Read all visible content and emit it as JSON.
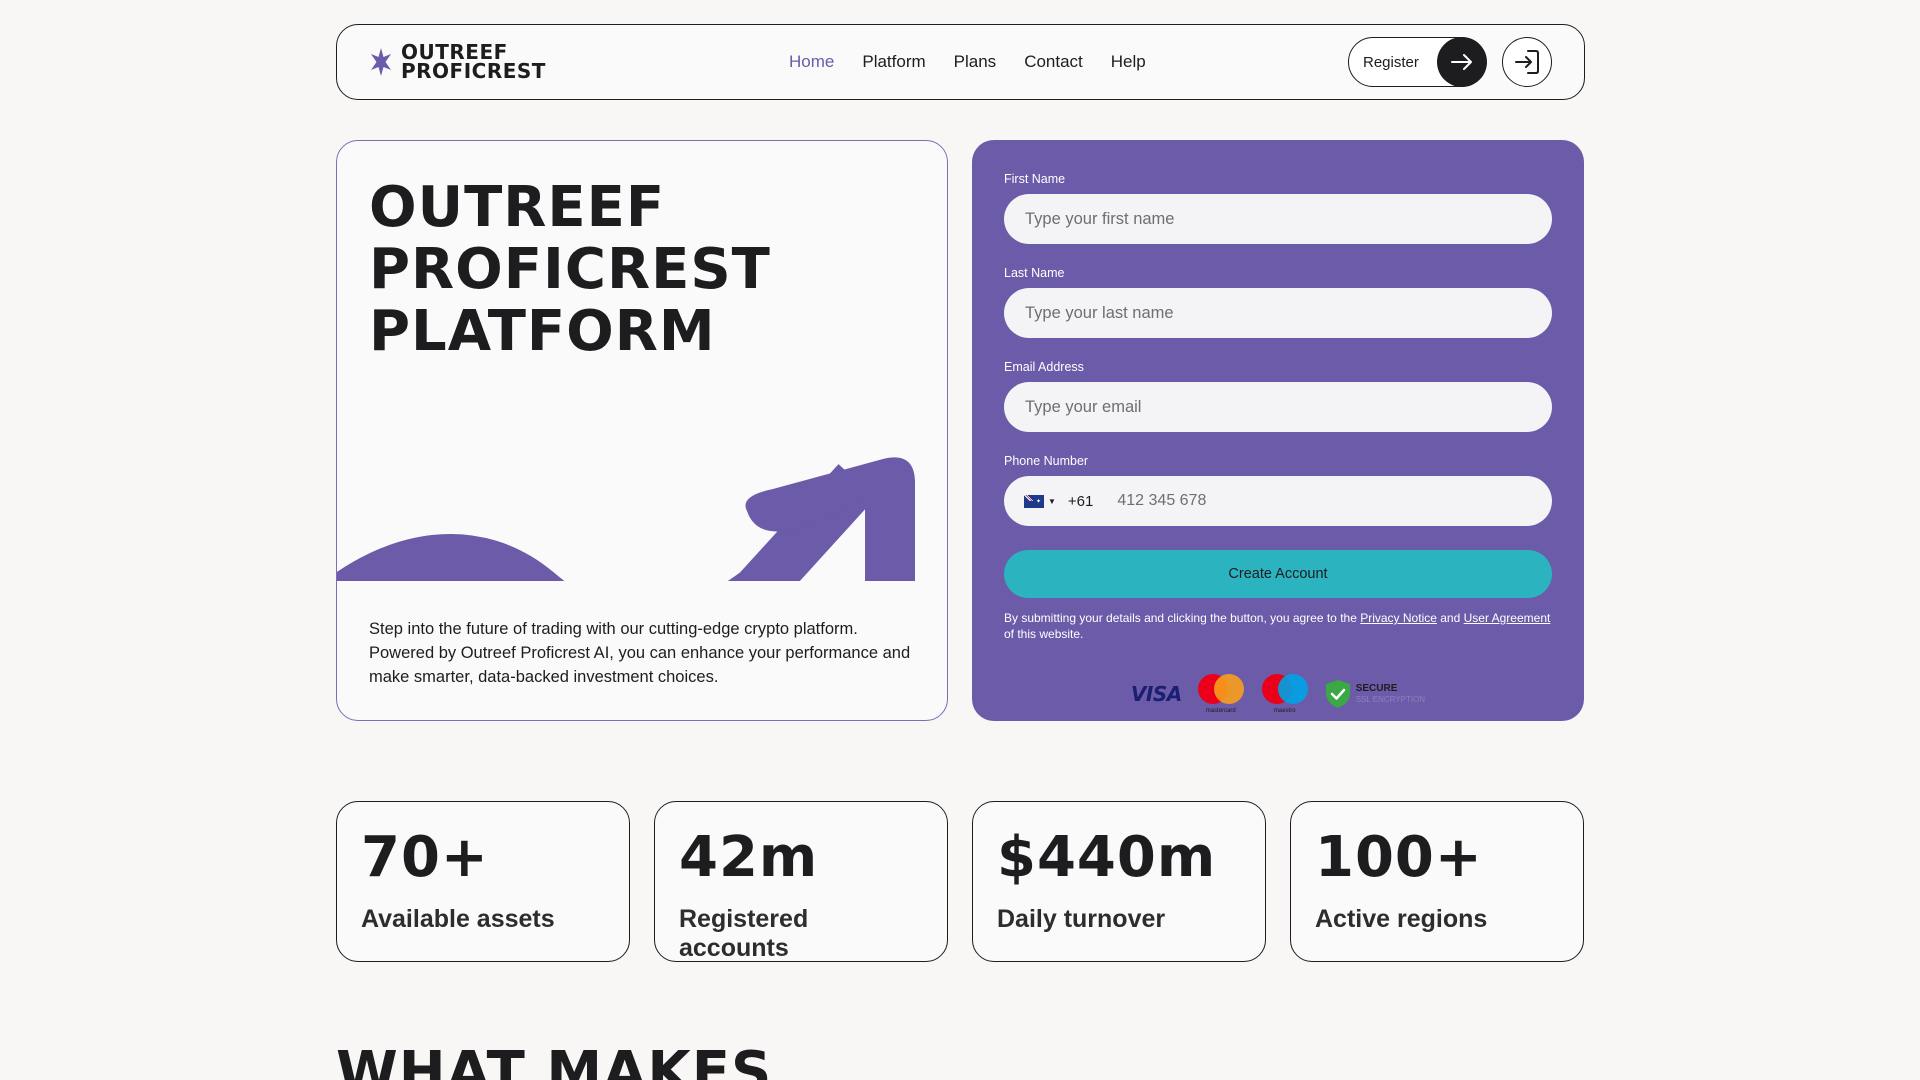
{
  "brand": {
    "name_line1": "OUTREEF",
    "name_line2": "PROFICREST",
    "accent": "#6b5ba8",
    "button_teal": "#2bb3c0"
  },
  "nav": {
    "items": [
      {
        "label": "Home",
        "active": true
      },
      {
        "label": "Platform",
        "active": false
      },
      {
        "label": "Plans",
        "active": false
      },
      {
        "label": "Contact",
        "active": false
      },
      {
        "label": "Help",
        "active": false
      }
    ]
  },
  "header": {
    "register_label": "Register",
    "register_icon": "arrow-right-icon",
    "login_icon": "login-icon"
  },
  "hero": {
    "title_line1": "OUTREEF",
    "title_line2": "PROFICREST",
    "title_line3": "PLATFORM",
    "description": "Step into the future of trading with our cutting-edge crypto platform. Powered by Outreef Proficrest AI, you can enhance your performance and make smarter, data-backed investment choices."
  },
  "form": {
    "first_name": {
      "label": "First Name",
      "placeholder": "Type your first name"
    },
    "last_name": {
      "label": "Last Name",
      "placeholder": "Type your last name"
    },
    "email": {
      "label": "Email Address",
      "placeholder": "Type your email"
    },
    "phone": {
      "label": "Phone Number",
      "dial_code": "+61",
      "placeholder": "412 345 678",
      "country_flag": "australia-flag-icon"
    },
    "submit_label": "Create Account",
    "terms_prefix": "By submitting your details and clicking the button, you agree to the",
    "privacy_link": "Privacy Notice",
    "terms_and": "and",
    "agreement_link": "User Agreement",
    "terms_suffix": "of this website.",
    "payments": {
      "visa": "VISA",
      "mastercard": "mastercard",
      "maestro": "maestro",
      "secure_title": "SECURE",
      "secure_sub": "SSL ENCRYPTION"
    }
  },
  "stats": [
    {
      "value": "70+",
      "label": "Available assets"
    },
    {
      "value": "42m",
      "label": "Registered accounts"
    },
    {
      "value": "$440m",
      "label": "Daily turnover"
    },
    {
      "value": "100+",
      "label": "Active regions"
    }
  ],
  "next_section": {
    "heading": "WHAT MAKES"
  }
}
